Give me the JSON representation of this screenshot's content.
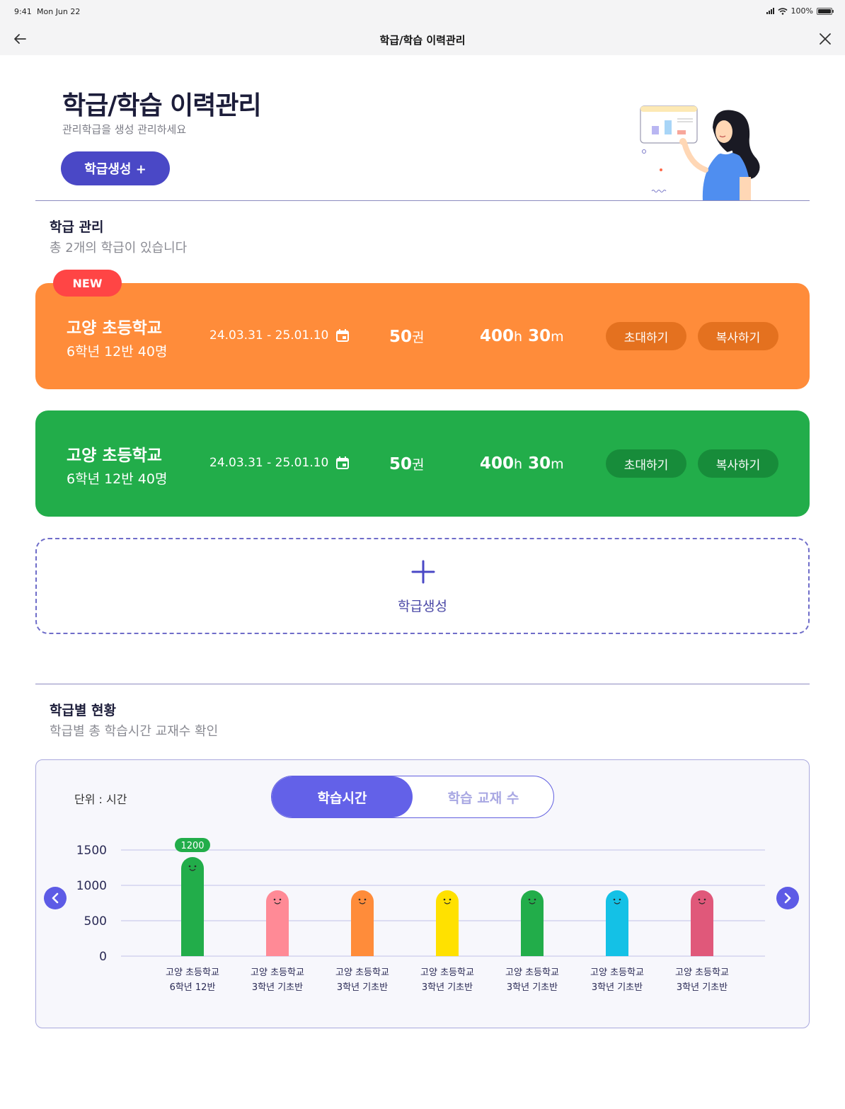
{
  "status": {
    "time": "9:41",
    "date": "Mon Jun 22",
    "battery": "100%"
  },
  "nav": {
    "title": "학급/학습 이력관리"
  },
  "hero": {
    "title": "학급/학습 이력관리",
    "subtitle": "관리학급을 생성 관리하세요",
    "create_label": "학급생성 +"
  },
  "classes_section": {
    "title": "학급 관리",
    "subtitle": "총 2개의 학급이 있습니다"
  },
  "classes": [
    {
      "badge": "NEW",
      "school": "고양 초등학교",
      "grade": "6학년 12반  40명",
      "dates": "24.03.31 - 25.01.10",
      "books_num": "50",
      "books_unit": "권",
      "hours_num": "400",
      "hours_unit": "h",
      "mins_num": "30",
      "mins_unit": "m",
      "invite_label": "초대하기",
      "copy_label": "복사하기",
      "color": "#ff8c3a"
    },
    {
      "school": "고양 초등학교",
      "grade": "6학년 12반  40명",
      "dates": "24.03.31 - 25.01.10",
      "books_num": "50",
      "books_unit": "권",
      "hours_num": "400",
      "hours_unit": "h",
      "mins_num": "30",
      "mins_unit": "m",
      "invite_label": "초대하기",
      "copy_label": "복사하기",
      "color": "#22ad4a"
    }
  ],
  "add_class": {
    "label": "학급생성"
  },
  "status_section": {
    "title": "학급별 현황",
    "subtitle": "학급별 총 학습시간 교재수  확인"
  },
  "chart_panel": {
    "unit_label": "단위 : 시간",
    "tab_active": "학습시간",
    "tab_inactive": "학습 교재 수"
  },
  "chart_data": {
    "type": "bar",
    "ylim": [
      0,
      1500
    ],
    "yticks": [
      0,
      500,
      1000,
      1500
    ],
    "grid": true,
    "categories": [
      [
        "고양 초등학교",
        "6학년 12반"
      ],
      [
        "고양 초등학교",
        "3학년 기초반"
      ],
      [
        "고양 초등학교",
        "3학년 기초반"
      ],
      [
        "고양 초등학교",
        "3학년 기초반"
      ],
      [
        "고양 초등학교",
        "3학년 기초반"
      ],
      [
        "고양 초등학교",
        "3학년 기초반"
      ],
      [
        "고양 초등학교",
        "3학년 기초반"
      ]
    ],
    "values": [
      1400,
      930,
      930,
      930,
      930,
      930,
      930
    ],
    "colors": [
      "#22ad4a",
      "#ff8a96",
      "#ff8c3a",
      "#ffe100",
      "#22ad4a",
      "#14c1e6",
      "#e0587a"
    ],
    "data_labels": [
      "1200",
      null,
      null,
      null,
      null,
      null,
      null
    ]
  }
}
